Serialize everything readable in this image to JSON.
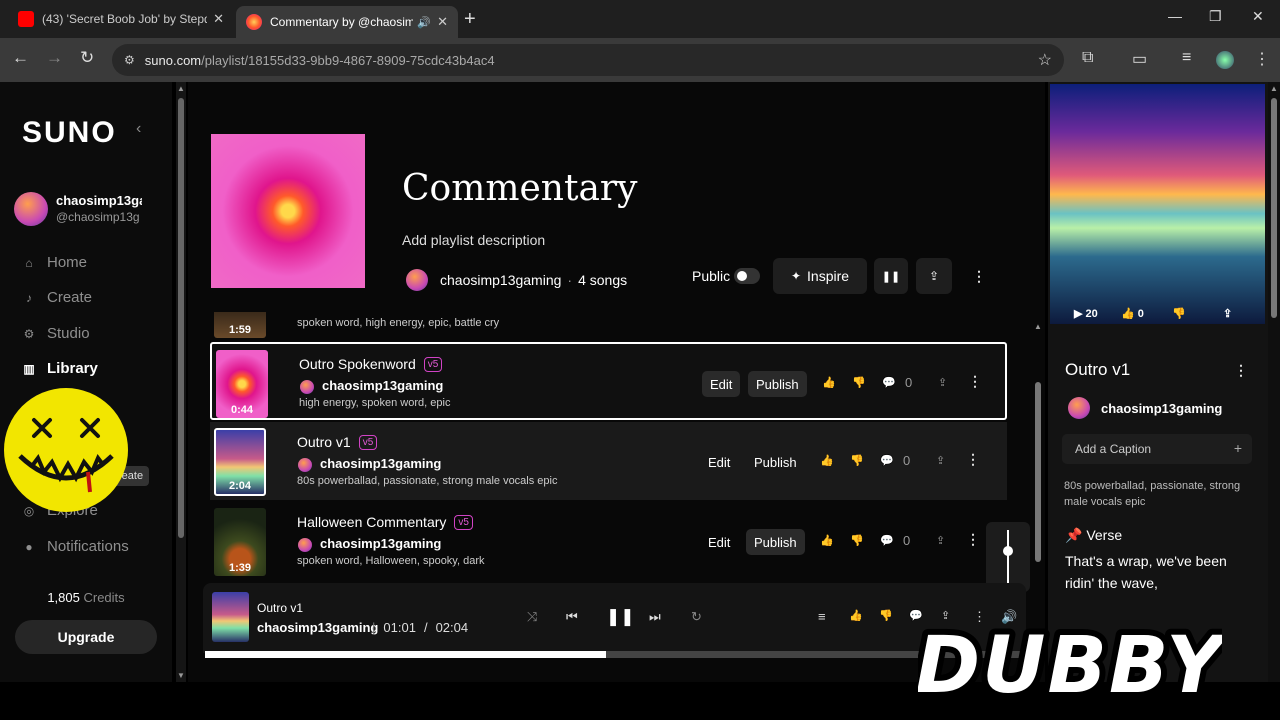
{
  "browser": {
    "tabs": [
      {
        "title": "(43) 'Secret Boob Job' by Stepd",
        "close": "✕"
      },
      {
        "title": "Commentary by @chaosim",
        "close": "✕"
      }
    ],
    "new_tab": "+",
    "url_host": "suno.com",
    "url_path": "/playlist/18155d33-9bb9-4867-8909-75cdc43b4ac4"
  },
  "sidebar": {
    "logo": "SUNO",
    "user_name": "chaosimp13ga",
    "user_handle": "@chaosimp13g",
    "nav": [
      {
        "label": "Home",
        "icon": "home-icon",
        "glyph": "⌂"
      },
      {
        "label": "Create",
        "icon": "create-icon",
        "glyph": "♪"
      },
      {
        "label": "Studio",
        "icon": "studio-icon",
        "glyph": "⚙"
      },
      {
        "label": "Library",
        "icon": "library-icon",
        "glyph": "▥"
      },
      {
        "label": "Explore",
        "icon": "explore-icon",
        "glyph": "◎"
      },
      {
        "label": "Notifications",
        "icon": "bell-icon",
        "glyph": "●"
      }
    ],
    "create_tooltip": "reate",
    "credits_value": "1,805",
    "credits_label": "Credits",
    "upgrade": "Upgrade"
  },
  "playlist": {
    "title": "Commentary",
    "description": "Add playlist description",
    "owner": "chaosimp13gaming",
    "song_count": "4 songs",
    "public_label": "Public",
    "inspire_label": "Inspire"
  },
  "songs": {
    "partial": {
      "duration": "1:59",
      "tags": "spoken word, high energy, epic, battle cry"
    },
    "rows": [
      {
        "title": "Outro Spokenword",
        "badge": "v5",
        "artist": "chaosimp13gaming",
        "tags": "high energy, spoken word, epic",
        "duration": "0:44",
        "edit": "Edit",
        "publish": "Publish",
        "comments": "0"
      },
      {
        "title": "Outro v1",
        "badge": "v5",
        "artist": "chaosimp13gaming",
        "tags": "80s powerballad, passionate, strong male vocals epic",
        "duration": "2:04",
        "edit": "Edit",
        "publish": "Publish",
        "comments": "0"
      },
      {
        "title": "Halloween Commentary",
        "badge": "v5",
        "artist": "chaosimp13gaming",
        "tags": "spoken word, Halloween, spooky, dark",
        "duration": "1:39",
        "edit": "Edit",
        "publish": "Publish",
        "comments": "0"
      }
    ]
  },
  "player": {
    "title": "Outro v1",
    "artist": "chaosimp13gaming",
    "current": "01:01",
    "total": "02:04",
    "progress": 0.49
  },
  "right_panel": {
    "plays": "20",
    "likes": "0",
    "title": "Outro v1",
    "artist": "chaosimp13gaming",
    "caption_placeholder": "Add a Caption",
    "tags": "80s powerballad, passionate, strong male vocals epic",
    "section": "Verse",
    "lyrics": "That's a wrap, we've been ridin' the wave,"
  },
  "overlay": {
    "watermark": "DUBBY"
  }
}
